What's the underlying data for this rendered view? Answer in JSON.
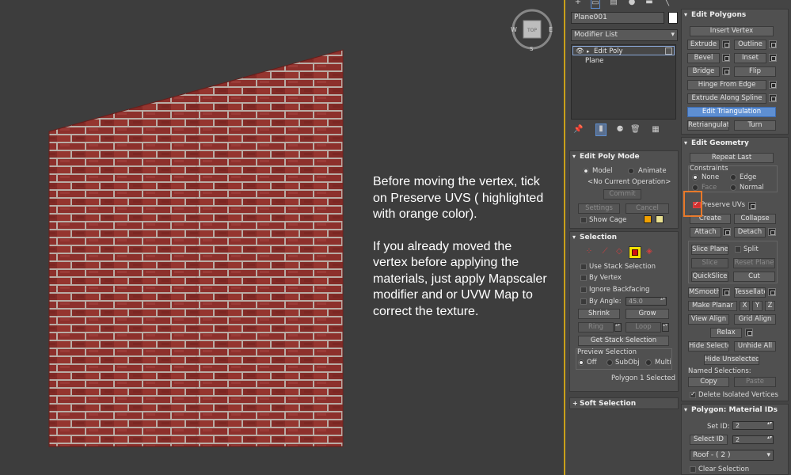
{
  "instructions": {
    "para1": "Before moving the vertex, tick on Preserve UVS ( highlighted with orange color).",
    "para2": "If you already moved the vertex  before applying the materials, just apply Mapscaler modifier and or UVW Map to correct the texture."
  },
  "viewcube": {
    "face": "TOP",
    "w": "W",
    "e": "E",
    "s": "S"
  },
  "object": {
    "name": "Plane001",
    "modifier_list": "Modifier List"
  },
  "modstack": {
    "item1": "Edit Poly",
    "item2": "Plane"
  },
  "edit_poly_mode": {
    "title": "Edit Poly Mode",
    "model": "Model",
    "animate": "Animate",
    "no_op": "<No Current Operation>",
    "commit": "Commit",
    "settings": "Settings",
    "cancel": "Cancel",
    "show_cage": "Show Cage"
  },
  "selection": {
    "title": "Selection",
    "use_stack": "Use Stack Selection",
    "by_vertex": "By Vertex",
    "ignore_backfacing": "Ignore Backfacing",
    "by_angle": "By Angle:",
    "angle_value": "45.0",
    "shrink": "Shrink",
    "grow": "Grow",
    "ring": "Ring",
    "loop": "Loop",
    "get_stack": "Get Stack Selection",
    "preview": "Preview Selection",
    "off": "Off",
    "subobj": "SubObj",
    "multi": "Multi",
    "status": "Polygon 1 Selected"
  },
  "soft_selection": {
    "title": "Soft Selection"
  },
  "edit_polygons": {
    "title": "Edit Polygons",
    "insert_vertex": "Insert Vertex",
    "extrude": "Extrude",
    "outline": "Outline",
    "bevel": "Bevel",
    "inset": "Inset",
    "bridge": "Bridge",
    "flip": "Flip",
    "hinge": "Hinge From Edge",
    "extrude_spline": "Extrude Along Spline",
    "edit_tri": "Edit Triangulation",
    "retriangulate": "Retriangulate",
    "turn": "Turn"
  },
  "edit_geometry": {
    "title": "Edit Geometry",
    "repeat_last": "Repeat Last",
    "constraints": "Constraints",
    "none": "None",
    "edge": "Edge",
    "face": "Face",
    "normal": "Normal",
    "preserve_uvs": "Preserve UVs",
    "create": "Create",
    "collapse": "Collapse",
    "attach": "Attach",
    "detach": "Detach",
    "slice_plane": "Slice Plane",
    "split": "Split",
    "slice": "Slice",
    "reset_plane": "Reset Plane",
    "quickslice": "QuickSlice",
    "cut": "Cut",
    "msmooth": "MSmooth",
    "tessellate": "Tessellate",
    "make_planar": "Make Planar",
    "x": "X",
    "y": "Y",
    "z": "Z",
    "view_align": "View Align",
    "grid_align": "Grid Align",
    "relax": "Relax",
    "hide_selected": "Hide Selected",
    "unhide_all": "Unhide All",
    "hide_unselected": "Hide Unselected",
    "named_selections": "Named Selections:",
    "copy": "Copy",
    "paste": "Paste",
    "delete_isolated": "Delete Isolated Vertices"
  },
  "material_ids": {
    "title": "Polygon: Material IDs",
    "set_id": "Set ID:",
    "set_id_value": "2",
    "select_id": "Select ID",
    "select_id_value": "2",
    "material": "Roof - ( 2 )",
    "clear_selection": "Clear Selection"
  },
  "colors": {
    "brick": "#9a3530",
    "mortar": "#c8b8b0",
    "highlight": "#e8792a",
    "accent_blue": "#5e8fd2"
  }
}
